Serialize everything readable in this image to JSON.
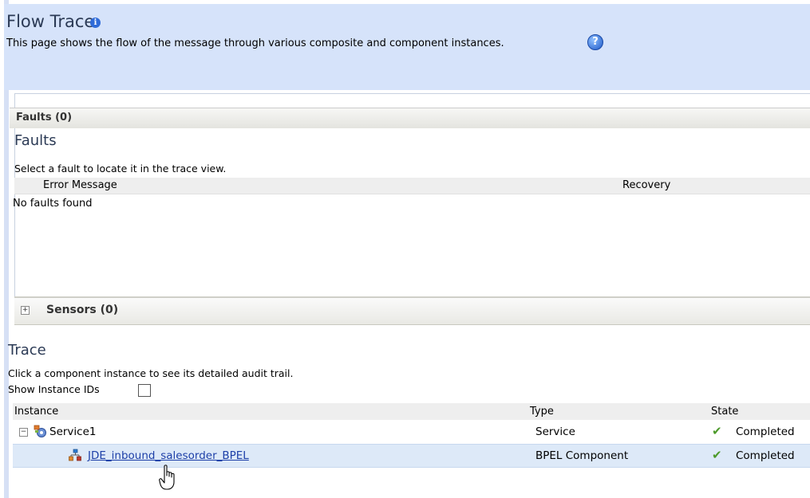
{
  "header": {
    "title": "Flow Trace",
    "description": "This page shows the flow of the message through various composite and component instances."
  },
  "faults": {
    "tab_label": "Faults (0)",
    "section_title": "Faults",
    "instruction": "Select a fault to locate it in the trace view.",
    "columns": [
      "Error Message",
      "Recovery"
    ],
    "empty_text": "No faults found"
  },
  "sensors": {
    "label": "Sensors (0)"
  },
  "trace": {
    "section_title": "Trace",
    "instruction": "Click a component instance to see its detailed audit trail.",
    "show_ids_label": "Show Instance IDs",
    "columns": [
      "Instance",
      "Type",
      "State"
    ],
    "rows": [
      {
        "instance": "Service1",
        "type": "Service",
        "state": "Completed"
      },
      {
        "instance": "JDE_inbound_salesorder_BPEL",
        "type": "BPEL Component",
        "state": "Completed"
      }
    ]
  },
  "icons": {
    "info": "info-icon",
    "help": "help-icon",
    "expand": "plus-icon",
    "collapse": "minus-icon",
    "service": "service-gears-icon",
    "bpel": "bpel-process-icon",
    "status": "green-checkmark-icon",
    "cursor": "hand-pointer-icon"
  },
  "colors": {
    "header_bg": "#d6e3fa",
    "title": "#2b3a55",
    "link": "#1d3fa8",
    "selected_row": "#dde9f8",
    "check": "#4c9a2a"
  }
}
